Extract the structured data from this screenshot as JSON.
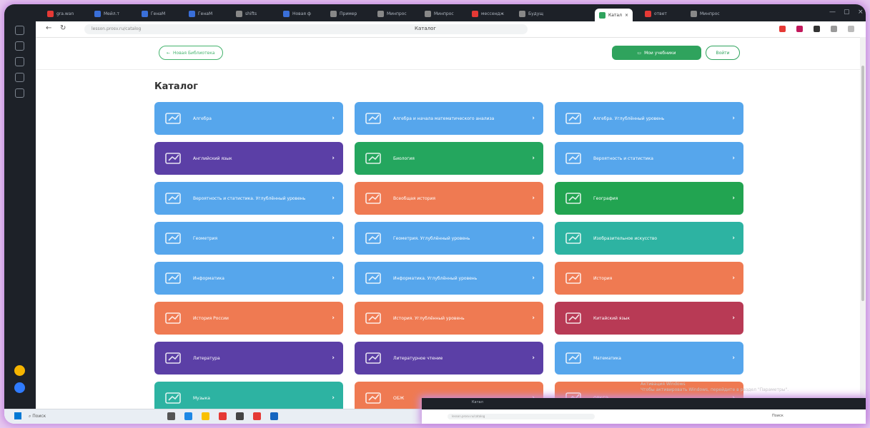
{
  "browser": {
    "tabs": [
      {
        "label": "gra.wan",
        "color": "#e53935"
      },
      {
        "label": "Мейл.т",
        "color": "#3a6fd8"
      },
      {
        "label": "ГенаМ",
        "color": "#3a6fd8"
      },
      {
        "label": "ГенаМ",
        "color": "#3a6fd8"
      },
      {
        "label": "shifts",
        "color": "#888888"
      },
      {
        "label": "Новая ф",
        "color": "#3a6fd8"
      },
      {
        "label": "Пример",
        "color": "#888888"
      },
      {
        "label": "Минпрос",
        "color": "#888888"
      },
      {
        "label": "Минпрос",
        "color": "#888888"
      },
      {
        "label": "мессендж",
        "color": "#e53935"
      },
      {
        "label": "Будущ",
        "color": "#888888"
      }
    ],
    "active_tab": "Катал",
    "extra_tabs": [
      {
        "label": "ответ",
        "color": "#e53935"
      },
      {
        "label": "Минпрос",
        "color": "#888888"
      }
    ],
    "url": "lesson.prosv.ru/catalog",
    "page_title": "Каталог"
  },
  "page": {
    "back_button": "Новая Библиотека",
    "primary_button": "Мои учебники",
    "outline_button": "Войти",
    "heading": "Каталог"
  },
  "catalog": [
    {
      "label": "Алгебра",
      "color": "blue",
      "icon": "chart-icon"
    },
    {
      "label": "Алгебра и начала математического анализа",
      "color": "blue",
      "icon": "chart-icon"
    },
    {
      "label": "Алгебра. Углублённый уровень",
      "color": "blue",
      "icon": "chart-icon"
    },
    {
      "label": "Английский язык",
      "color": "purple",
      "icon": "flag-icon"
    },
    {
      "label": "Биология",
      "color": "green",
      "icon": "leaf-icon"
    },
    {
      "label": "Вероятность и статистика",
      "color": "blue",
      "icon": "dice-icon"
    },
    {
      "label": "Вероятность и статистика. Углублённый уровень",
      "color": "blue",
      "icon": "dice-icon"
    },
    {
      "label": "Всеобщая история",
      "color": "orange",
      "icon": "columns-icon"
    },
    {
      "label": "География",
      "color": "dgreen",
      "icon": "map-icon"
    },
    {
      "label": "Геометрия",
      "color": "blue",
      "icon": "triangle-icon"
    },
    {
      "label": "Геометрия. Углублённый уровень",
      "color": "blue",
      "icon": "triangle-icon"
    },
    {
      "label": "Изобразительное искусство",
      "color": "teal",
      "icon": "palette-icon"
    },
    {
      "label": "Информатика",
      "color": "blue",
      "icon": "laptop-icon"
    },
    {
      "label": "Информатика. Углублённый уровень",
      "color": "blue",
      "icon": "laptop-icon"
    },
    {
      "label": "История",
      "color": "orange",
      "icon": "scroll-icon"
    },
    {
      "label": "История России",
      "color": "orange",
      "icon": "eagle-icon"
    },
    {
      "label": "История. Углублённый уровень",
      "color": "orange",
      "icon": "scroll-icon"
    },
    {
      "label": "Китайский язык",
      "color": "crimson",
      "icon": "lines-icon"
    },
    {
      "label": "Литература",
      "color": "purple",
      "icon": "book-icon"
    },
    {
      "label": "Литературное чтение",
      "color": "purple",
      "icon": "book-icon"
    },
    {
      "label": "Математика",
      "color": "blue",
      "icon": "calc-icon"
    },
    {
      "label": "Музыка",
      "color": "teal",
      "icon": "music-icon"
    },
    {
      "label": "ОБЖ",
      "color": "orange",
      "icon": "shield-icon"
    },
    {
      "label": "ОРКСЭ",
      "color": "orange",
      "icon": "book-icon"
    }
  ],
  "watermark": {
    "line1": "Активация Windows",
    "line2": "Чтобы активировать Windows, перейдите в раздел \"Параметры\"."
  },
  "taskbar": {
    "search_placeholder": "Поиск"
  },
  "overlay": {
    "title": "Катал",
    "page_title": "Поиск"
  }
}
